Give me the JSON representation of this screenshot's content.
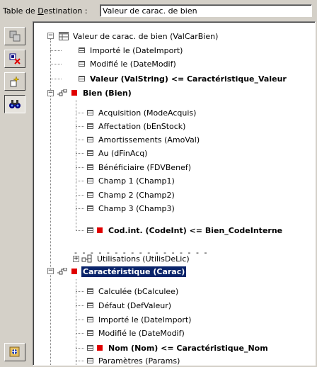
{
  "header": {
    "label_prefix": "Table de ",
    "label_accel": "D",
    "label_suffix": "estination :",
    "destination_value": "Valeur de carac. de bien"
  },
  "tree": {
    "root": "Valeur de carac. de bien (ValCarBien)",
    "f_import": "Importé le (DateImport)",
    "f_modif": "Modifié le (DateModif)",
    "f_valeur": "Valeur (ValString)  <=  Caractéristique_Valeur",
    "link_bien": "Bien (Bien)",
    "bien_fields": [
      "Acquisition (ModeAcquis)",
      "Affectation (bEnStock)",
      "Amortissements (AmoVal)",
      "Au (dFinAcq)",
      "Bénéficiaire (FDVBenef)",
      "Champ 1 (Champ1)",
      "Champ 2 (Champ2)",
      "Champ 3 (Champ3)"
    ],
    "bien_codeint": "Cod.int. (CodeInt)  <=  Bien_CodeInterne",
    "separator": "- - - - - - - - - - - - - - - - -",
    "utilisations": "Utilisations (UtilisDeLic)",
    "link_carac": "Caractéristique (Carac)",
    "carac_fields": [
      "Calculée (bCalculee)",
      "Défaut (DefValeur)",
      "Importé le (DateImport)",
      "Modifié le (DateModif)"
    ],
    "carac_nom": "Nom (Nom)  <=  Caractéristique_Nom",
    "carac_params": "Paramètres (Params)"
  }
}
